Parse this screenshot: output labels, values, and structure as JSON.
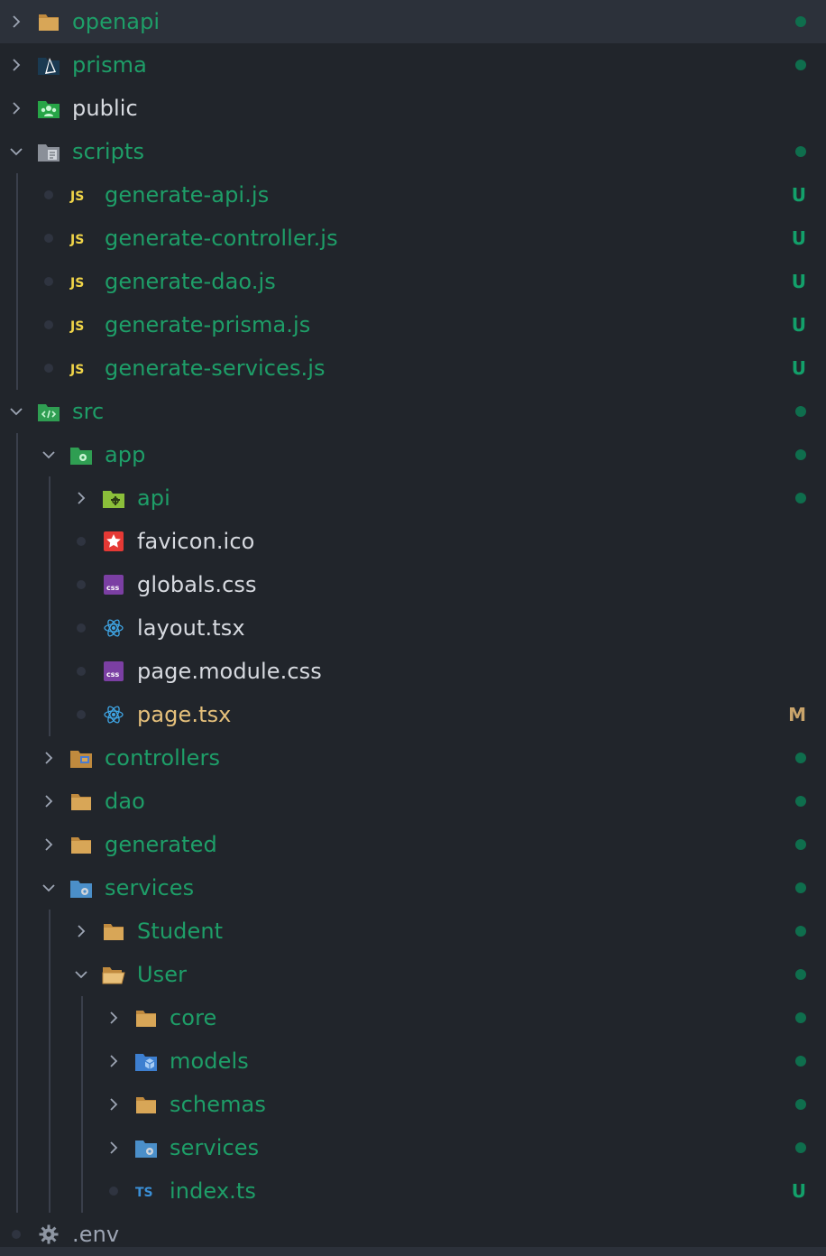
{
  "colors": {
    "background": "#21252b",
    "selected_row": "#2c313a",
    "untracked_green": "#1e9e68",
    "modified_orange": "#e5c07b",
    "plain_text": "#d7dae0",
    "badge_untracked": "#13a06a",
    "badge_modified": "#c9a46b",
    "dot_green": "#0f6e4d"
  },
  "rows": [
    {
      "name": "openapi",
      "type": "folder",
      "state": "collapsed",
      "depth": 0,
      "icon": "folder-icon",
      "color": "green",
      "badge": "dot",
      "selected": true
    },
    {
      "name": "prisma",
      "type": "folder",
      "state": "collapsed",
      "depth": 0,
      "icon": "prisma-icon",
      "color": "green",
      "badge": "dot"
    },
    {
      "name": "public",
      "type": "folder",
      "state": "collapsed",
      "depth": 0,
      "icon": "public-folder-icon",
      "color": "white",
      "badge": ""
    },
    {
      "name": "scripts",
      "type": "folder",
      "state": "expanded",
      "depth": 0,
      "icon": "scripts-folder-icon",
      "color": "green",
      "badge": "dot"
    },
    {
      "name": "generate-api.js",
      "type": "file",
      "depth": 1,
      "icon": "js-file-icon",
      "color": "green",
      "badge": "U"
    },
    {
      "name": "generate-controller.js",
      "type": "file",
      "depth": 1,
      "icon": "js-file-icon",
      "color": "green",
      "badge": "U"
    },
    {
      "name": "generate-dao.js",
      "type": "file",
      "depth": 1,
      "icon": "js-file-icon",
      "color": "green",
      "badge": "U"
    },
    {
      "name": "generate-prisma.js",
      "type": "file",
      "depth": 1,
      "icon": "js-file-icon",
      "color": "green",
      "badge": "U"
    },
    {
      "name": "generate-services.js",
      "type": "file",
      "depth": 1,
      "icon": "js-file-icon",
      "color": "green",
      "badge": "U"
    },
    {
      "name": "src",
      "type": "folder",
      "state": "expanded",
      "depth": 0,
      "icon": "src-folder-icon",
      "color": "green",
      "badge": "dot"
    },
    {
      "name": "app",
      "type": "folder",
      "state": "expanded",
      "depth": 1,
      "icon": "app-folder-icon",
      "color": "green",
      "badge": "dot"
    },
    {
      "name": "api",
      "type": "folder",
      "state": "collapsed",
      "depth": 2,
      "icon": "api-folder-icon",
      "color": "green",
      "badge": "dot"
    },
    {
      "name": "favicon.ico",
      "type": "file",
      "depth": 2,
      "icon": "favicon-icon",
      "color": "white",
      "badge": ""
    },
    {
      "name": "globals.css",
      "type": "file",
      "depth": 2,
      "icon": "css-file-icon",
      "color": "white",
      "badge": ""
    },
    {
      "name": "layout.tsx",
      "type": "file",
      "depth": 2,
      "icon": "react-icon",
      "color": "white",
      "badge": ""
    },
    {
      "name": "page.module.css",
      "type": "file",
      "depth": 2,
      "icon": "css-file-icon",
      "color": "white",
      "badge": ""
    },
    {
      "name": "page.tsx",
      "type": "file",
      "depth": 2,
      "icon": "react-icon",
      "color": "orange",
      "badge": "M"
    },
    {
      "name": "controllers",
      "type": "folder",
      "state": "collapsed",
      "depth": 1,
      "icon": "controllers-folder-icon",
      "color": "green",
      "badge": "dot"
    },
    {
      "name": "dao",
      "type": "folder",
      "state": "collapsed",
      "depth": 1,
      "icon": "folder-icon",
      "color": "green",
      "badge": "dot"
    },
    {
      "name": "generated",
      "type": "folder",
      "state": "collapsed",
      "depth": 1,
      "icon": "folder-icon",
      "color": "green",
      "badge": "dot"
    },
    {
      "name": "services",
      "type": "folder",
      "state": "expanded",
      "depth": 1,
      "icon": "services-folder-icon",
      "color": "green",
      "badge": "dot"
    },
    {
      "name": "Student",
      "type": "folder",
      "state": "collapsed",
      "depth": 2,
      "icon": "folder-icon",
      "color": "green",
      "badge": "dot"
    },
    {
      "name": "User",
      "type": "folder",
      "state": "expanded",
      "depth": 2,
      "icon": "folder-open-icon",
      "color": "green",
      "badge": "dot"
    },
    {
      "name": "core",
      "type": "folder",
      "state": "collapsed",
      "depth": 3,
      "icon": "folder-icon",
      "color": "green",
      "badge": "dot"
    },
    {
      "name": "models",
      "type": "folder",
      "state": "collapsed",
      "depth": 3,
      "icon": "models-folder-icon",
      "color": "green",
      "badge": "dot"
    },
    {
      "name": "schemas",
      "type": "folder",
      "state": "collapsed",
      "depth": 3,
      "icon": "folder-icon",
      "color": "green",
      "badge": "dot"
    },
    {
      "name": "services",
      "type": "folder",
      "state": "collapsed",
      "depth": 3,
      "icon": "services-folder-icon",
      "color": "green",
      "badge": "dot"
    },
    {
      "name": "index.ts",
      "type": "file",
      "depth": 3,
      "icon": "ts-file-icon",
      "color": "green",
      "badge": "U"
    },
    {
      "name": ".env",
      "type": "file",
      "depth": 0,
      "icon": "gear-icon",
      "color": "gray",
      "badge": ""
    }
  ]
}
